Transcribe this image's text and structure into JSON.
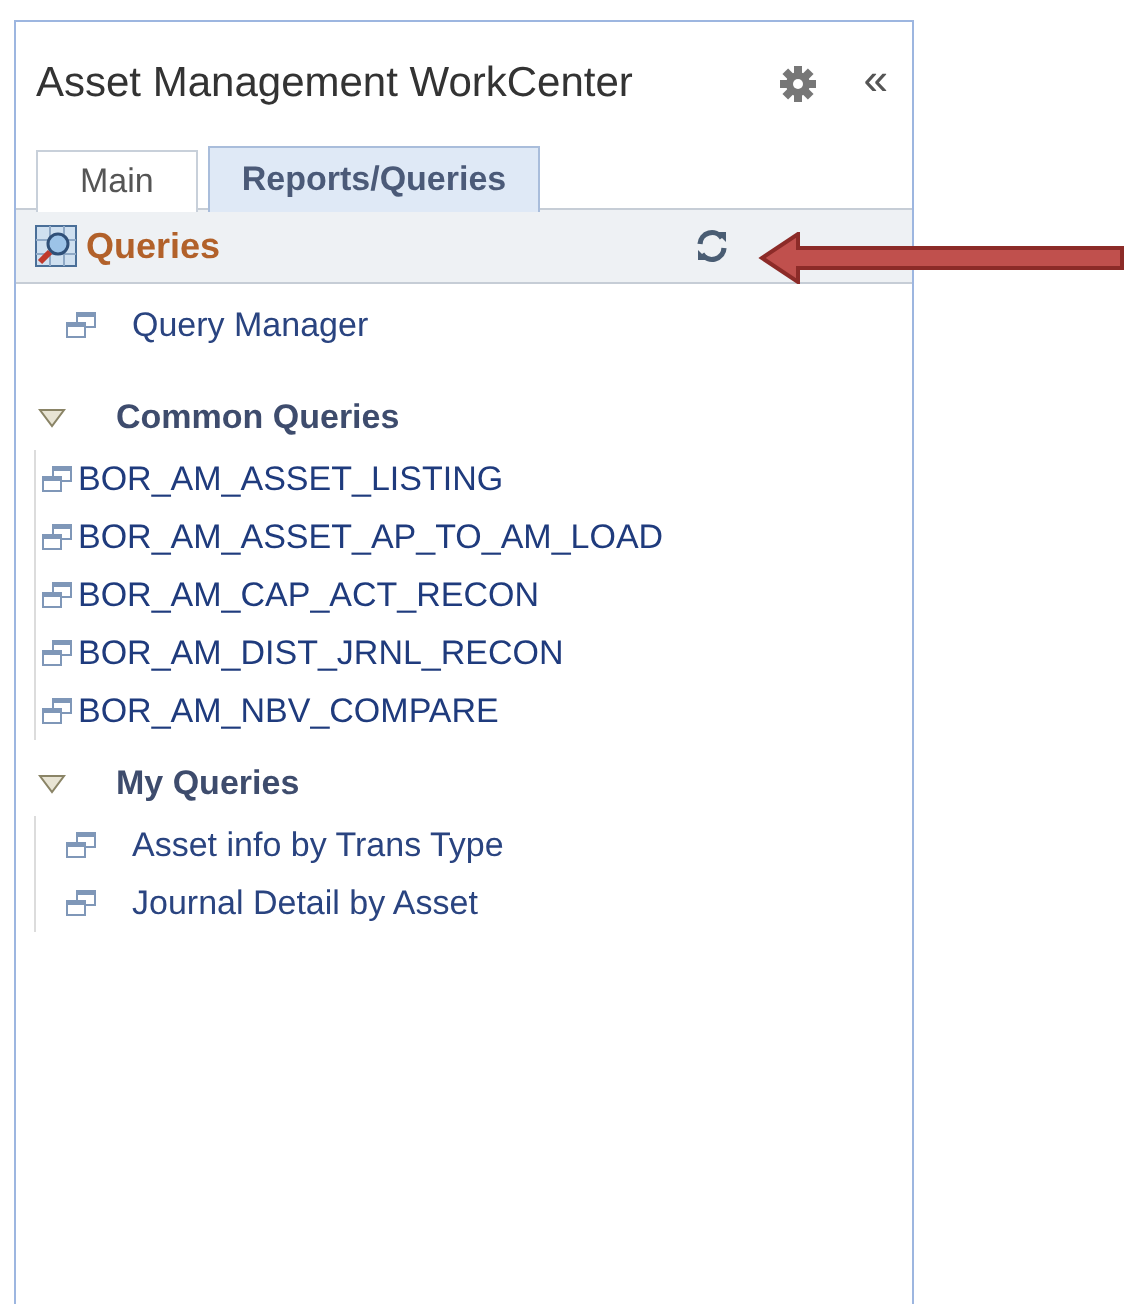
{
  "panel": {
    "title": "Asset Management WorkCenter",
    "collapse_glyph": "«"
  },
  "tabs": [
    {
      "label": "Main",
      "selected": false
    },
    {
      "label": "Reports/Queries",
      "selected": true
    }
  ],
  "section": {
    "title": "Queries"
  },
  "links": [
    "Query Manager"
  ],
  "groups": [
    {
      "title": "Common Queries",
      "expanded": true,
      "indent": false,
      "items": [
        "BOR_AM_ASSET_LISTING",
        "BOR_AM_ASSET_AP_TO_AM_LOAD",
        "BOR_AM_CAP_ACT_RECON",
        "BOR_AM_DIST_JRNL_RECON",
        "BOR_AM_NBV_COMPARE"
      ]
    },
    {
      "title": "My Queries",
      "expanded": true,
      "indent": true,
      "items": [
        "Asset info by Trans Type",
        "Journal Detail by Asset"
      ]
    }
  ]
}
